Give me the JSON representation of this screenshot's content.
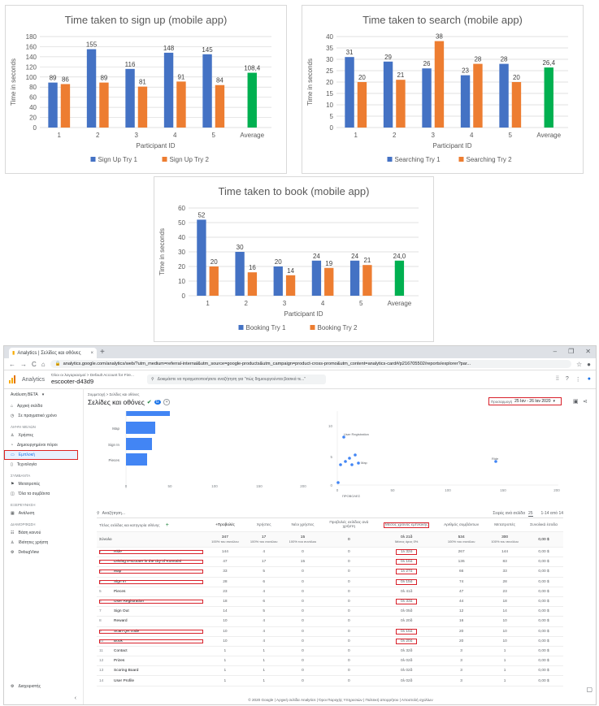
{
  "chart_data": [
    {
      "type": "bar",
      "title": "Time taken to sign up (mobile app)",
      "xlabel": "Participant ID",
      "ylabel": "Time in seconds",
      "categories": [
        "1",
        "2",
        "3",
        "4",
        "5",
        "Average"
      ],
      "ylim": [
        0,
        180
      ],
      "yticks": [
        0,
        20,
        40,
        60,
        80,
        100,
        120,
        140,
        160,
        180
      ],
      "series": [
        {
          "name": "Sign Up Try 1",
          "color": "#4472c4",
          "values": [
            89,
            155,
            116,
            148,
            145,
            null
          ]
        },
        {
          "name": "Sign Up Try 2",
          "color": "#ed7d31",
          "values": [
            86,
            89,
            81,
            91,
            84,
            null
          ]
        }
      ],
      "average": {
        "value": 108.4,
        "label": "108,4",
        "color": "#00b050"
      },
      "legend": "bottom",
      "grid": true
    },
    {
      "type": "bar",
      "title": "Time taken to search (mobile app)",
      "xlabel": "Participant ID",
      "ylabel": "Time in seconds",
      "categories": [
        "1",
        "2",
        "3",
        "4",
        "5",
        "Average"
      ],
      "ylim": [
        0,
        40
      ],
      "yticks": [
        0,
        5,
        10,
        15,
        20,
        25,
        30,
        35,
        40
      ],
      "series": [
        {
          "name": "Searching Try 1",
          "color": "#4472c4",
          "values": [
            31,
            29,
            26,
            23,
            28,
            null
          ]
        },
        {
          "name": "Searching Try 2",
          "color": "#ed7d31",
          "values": [
            20,
            21,
            38,
            28,
            20,
            null
          ]
        }
      ],
      "average": {
        "value": 26.4,
        "label": "26,4",
        "color": "#00b050"
      },
      "legend": "bottom",
      "grid": true
    },
    {
      "type": "bar",
      "title": "Time taken to book (mobile app)",
      "xlabel": "Participant ID",
      "ylabel": "Time in seconds",
      "categories": [
        "1",
        "2",
        "3",
        "4",
        "5",
        "Average"
      ],
      "ylim": [
        0,
        60
      ],
      "yticks": [
        0,
        10,
        20,
        30,
        40,
        50,
        60
      ],
      "series": [
        {
          "name": "Booking Try 1",
          "color": "#4472c4",
          "values": [
            52,
            30,
            20,
            24,
            24,
            null
          ]
        },
        {
          "name": "Booking Try 2",
          "color": "#ed7d31",
          "values": [
            20,
            16,
            14,
            19,
            21,
            null
          ]
        }
      ],
      "average": {
        "value": 24.0,
        "label": "24,0",
        "color": "#00b050"
      },
      "legend": "bottom",
      "grid": true
    }
  ],
  "browser": {
    "tab_title": "Analytics | Σελίδες και οθόνες",
    "tab_close": "×",
    "new_tab": "+",
    "url": "analytics.google.com/analytics/web/?utm_medium=referral-internal&utm_source=google-products&utm_campaign=product-cross-promo&utm_content=analytics-card#/p216705502/reports/explorer?par...",
    "nav_back": "←",
    "nav_forward": "→",
    "reload": "C",
    "home": "⌂"
  },
  "ga": {
    "product": "Analytics",
    "breadcrumb_small": "Όλοι οι λογαριασμοί > Default Account for Fire...",
    "property": "escooter-d43d9",
    "search_placeholder": "Δοκιμάστε να πραγματοποιήσετε αναζήτηση για \"πώς δημιουργούνται βασικά τε...\"",
    "page_breadcrumb": "Συμμετοχή > Σελίδες και οθόνες",
    "page_title": "Σελίδες και οθόνες",
    "date_range_label": "Προσαρμογή",
    "date_range": "25 Ιαν - 26 Ιαν 2020",
    "sidebar": {
      "top": "Ανάλυση ΒΕΤΑ",
      "items_1": [
        "Αρχική σελίδα",
        "Σε πραγματικό χρόνο"
      ],
      "head_1": "ΛΗΨΗ ΜΕΛΩΝ",
      "items_2": [
        "Χρήστες",
        "Δημιουργημένοι πόροι",
        "Εμπλοκή",
        "Τεχνολογία"
      ],
      "active": "Εμπλοκή",
      "head_2": "ΣΥΜΒΑΝΤΑ",
      "items_3": [
        "Μετατροπές",
        "Όλα τα συμβάντα"
      ],
      "head_3": "ΕΞΕΡΕΥΝΗΣΗ",
      "items_4": [
        "Ανάλυση"
      ],
      "head_4": "ΔΙΑΜΟΡΦΩΣΗ",
      "items_5": [
        "Βάση κοινού",
        "Ιδιότητες χρήστη",
        "DebugView"
      ],
      "admin": "Διαχειριστής"
    },
    "hbar_labels": [
      "Map",
      "Sign In",
      "Pieces"
    ],
    "hbar_axis": [
      "0",
      "50",
      "100",
      "150",
      "200"
    ],
    "scatter_labels": [
      "User Registration",
      "Ride",
      "Map"
    ],
    "scatter_xlabel": "ΠΡΟΒΟΛΕΣ",
    "scatter_axis": [
      "0",
      "50",
      "100",
      "150",
      "200"
    ],
    "scatter_yaxis": [
      "10",
      "5",
      "0"
    ],
    "table_search": "Αναζήτηση...",
    "rows_per_page_label": "Σειρές ανά σελίδα",
    "rows_per_page": "25",
    "pagination": "1-14 από 14",
    "columns": [
      "Τίτλος σελίδας και κατηγορία οθόνης",
      "+Προβολές",
      "Χρήστες",
      "Νέοι χρήστες",
      "Προβολές σελίδας ανά χρήστη",
      "Μέσος χρόνος εμπλοκής",
      "Αριθμός συμβάντων",
      "Μετατροπές",
      "Συνολικά έσοδα"
    ],
    "totals": [
      "Σύνολο",
      "347",
      "17",
      "15",
      "0",
      "0λ 21δ",
      "534",
      "300",
      "0,00 $"
    ],
    "totals_sub": [
      "",
      "100% του συνόλου",
      "100% του συνόλου",
      "100% του συνόλου",
      "",
      "Μέσος όρος 0%",
      "100% του συνόλου",
      "100% του συνόλου",
      ""
    ],
    "rows": [
      {
        "n": "1",
        "name": "Ride",
        "v": [
          "144",
          "4",
          "0",
          "0",
          "1λ 32δ",
          "267",
          "144",
          "0,00 $"
        ],
        "hl": true
      },
      {
        "n": "2",
        "name": "Driving e-scooter in the city of Komotini",
        "v": [
          "47",
          "17",
          "15",
          "0",
          "0λ 16δ",
          "136",
          "83",
          "0,00 $"
        ],
        "hl": true
      },
      {
        "n": "3",
        "name": "Map",
        "v": [
          "33",
          "5",
          "0",
          "0",
          "1λ 27δ",
          "66",
          "33",
          "0,00 $"
        ],
        "hl": true
      },
      {
        "n": "4",
        "name": "Sign In",
        "v": [
          "28",
          "6",
          "0",
          "0",
          "0λ 15δ",
          "74",
          "28",
          "0,00 $"
        ],
        "hl": true
      },
      {
        "n": "5",
        "name": "Pieces",
        "v": [
          "23",
          "4",
          "0",
          "0",
          "0λ 41δ",
          "47",
          "23",
          "0,00 $"
        ],
        "hl": false
      },
      {
        "n": "6",
        "name": "User Registration",
        "v": [
          "18",
          "6",
          "0",
          "0",
          "0λ 33δ",
          "44",
          "18",
          "0,00 $"
        ],
        "hl": true
      },
      {
        "n": "7",
        "name": "Sign Out",
        "v": [
          "14",
          "5",
          "0",
          "0",
          "0λ 05δ",
          "12",
          "14",
          "0,00 $"
        ],
        "hl": false
      },
      {
        "n": "8",
        "name": "Reward",
        "v": [
          "10",
          "4",
          "0",
          "0",
          "0λ 20δ",
          "16",
          "10",
          "0,00 $"
        ],
        "hl": false
      },
      {
        "n": "9",
        "name": "Scan QR code",
        "v": [
          "10",
          "4",
          "0",
          "0",
          "0λ 15δ",
          "20",
          "10",
          "0,00 $"
        ],
        "hl": true
      },
      {
        "n": "10",
        "name": "Book",
        "v": [
          "10",
          "4",
          "0",
          "0",
          "0λ 20δ",
          "20",
          "10",
          "0,00 $"
        ],
        "hl": true
      },
      {
        "n": "11",
        "name": "Contact",
        "v": [
          "1",
          "1",
          "0",
          "0",
          "0λ 32δ",
          "3",
          "1",
          "0,00 $"
        ],
        "hl": false
      },
      {
        "n": "12",
        "name": "Prizes",
        "v": [
          "1",
          "1",
          "0",
          "0",
          "0λ 02δ",
          "3",
          "1",
          "0,00 $"
        ],
        "hl": false
      },
      {
        "n": "13",
        "name": "Scoring Board",
        "v": [
          "1",
          "1",
          "0",
          "0",
          "0λ 02δ",
          "3",
          "1",
          "0,00 $"
        ],
        "hl": false
      },
      {
        "n": "14",
        "name": "User Profile",
        "v": [
          "1",
          "1",
          "0",
          "0",
          "0λ 02δ",
          "3",
          "1",
          "0,00 $"
        ],
        "hl": false
      }
    ],
    "footer": "© 2020 Google | Αρχική σελίδα Analytics | Όροι Παροχής Υπηρεσιών | Πολιτική απορρήτου | Αποστολή σχολίων"
  }
}
